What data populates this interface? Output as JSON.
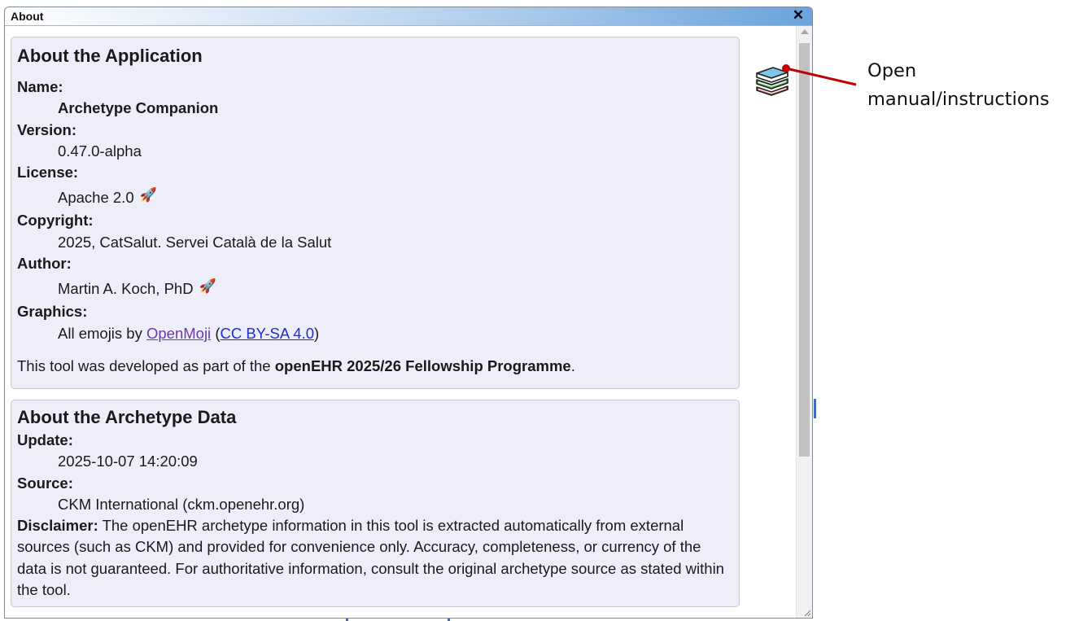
{
  "window": {
    "title": "About",
    "close_glyph": "✕"
  },
  "about_app": {
    "heading": "About the Application",
    "fields": {
      "name_label": "Name:",
      "name_value": "Archetype Companion",
      "version_label": "Version:",
      "version_value": "0.47.0-alpha",
      "license_label": "License:",
      "license_value": "Apache 2.0",
      "copyright_label": "Copyright:",
      "copyright_value": "2025, CatSalut. Servei Català de la Salut",
      "author_label": "Author:",
      "author_value": "Martin A. Koch, PhD",
      "graphics_label": "Graphics:",
      "graphics_prefix": "All emojis by",
      "graphics_link": "OpenMoji",
      "graphics_open_paren": "(",
      "graphics_license_link": "CC BY-SA 4.0",
      "graphics_close_paren": ")"
    },
    "credit_prefix": "This tool was developed as part of the",
    "credit_bold": "openEHR 2025/26 Fellowship Programme",
    "credit_suffix": ".",
    "rocket_glyph": "🚀"
  },
  "about_data": {
    "heading": "About the Archetype Data",
    "update_label": "Update:",
    "update_value": "2025-10-07 14:20:09",
    "source_label": "Source:",
    "source_value": "CKM International (ckm.openehr.org)",
    "disclaimer_label": "Disclaimer:",
    "disclaimer_text": "The openEHR archetype information in this tool is extracted automatically from external sources (such as CKM) and provided for convenience only. Accuracy, completeness, or currency of the data is not guaranteed. For authoritative information, consult the original archetype source as stated within the tool."
  },
  "manual_button": {
    "icon": "books-icon"
  },
  "callout": {
    "text": "Open\nmanual/instructions",
    "color": "#c00000"
  },
  "colors": {
    "panel_bg": "#eeeefa",
    "link": "#1a2ed1",
    "visited_link": "#6b3aa6"
  }
}
